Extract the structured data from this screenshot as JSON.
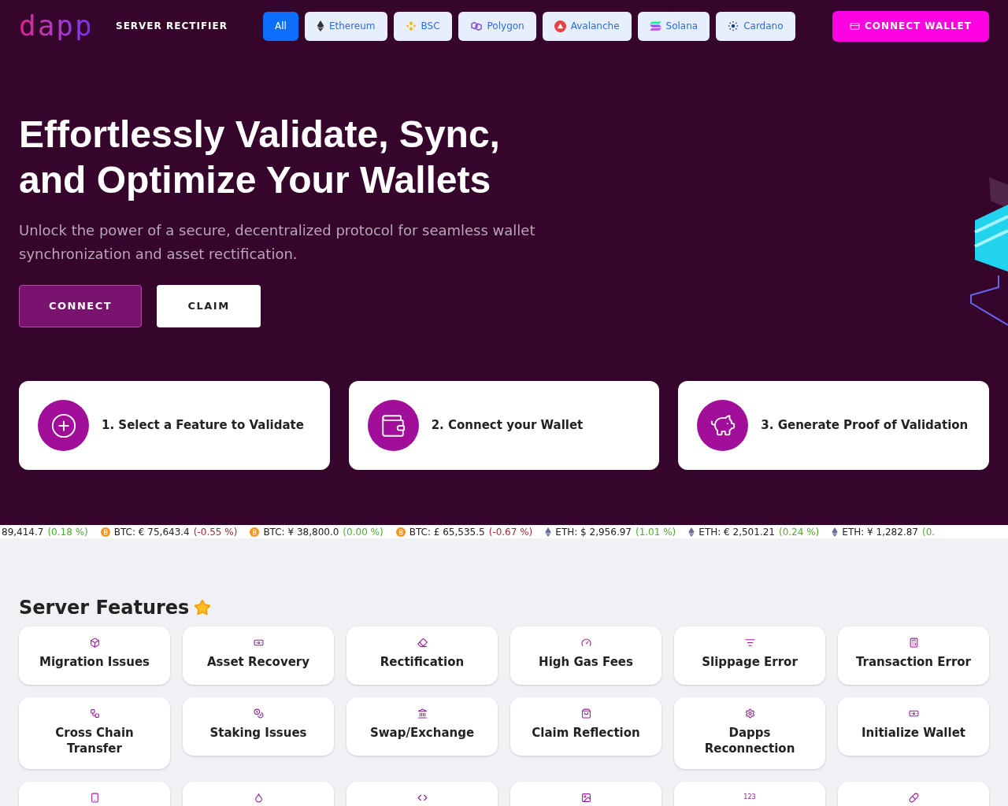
{
  "header": {
    "logo": "dapp",
    "title": "SERVER RECTIFIER",
    "chains": [
      {
        "label": "All",
        "kind": "all",
        "selected": true
      },
      {
        "label": "Ethereum",
        "kind": "eth",
        "selected": false
      },
      {
        "label": "BSC",
        "kind": "bsc",
        "selected": false
      },
      {
        "label": "Polygon",
        "kind": "polygon",
        "selected": false
      },
      {
        "label": "Avalanche",
        "kind": "avax",
        "selected": false
      },
      {
        "label": "Solana",
        "kind": "sol",
        "selected": false
      },
      {
        "label": "Cardano",
        "kind": "ada",
        "selected": false
      }
    ],
    "connect_wallet": "CONNECT WALLET"
  },
  "hero": {
    "title_lines": [
      "Effortlessly Validate, Sync,",
      "and Optimize Your Wallets"
    ],
    "subtitle": "Unlock the power of a secure, decentralized protocol for seamless wallet synchronization and asset rectification.",
    "buttons": [
      {
        "label": "CONNECT",
        "kind": "primary"
      },
      {
        "label": "CLAIM",
        "kind": "secondary"
      }
    ]
  },
  "steps": [
    {
      "label": "1. Select a Feature to Validate",
      "kind": "plus"
    },
    {
      "label": "2. Connect your Wallet",
      "kind": "wallet"
    },
    {
      "label": "3. Generate Proof of Validation",
      "kind": "piggy"
    }
  ],
  "ticker": [
    {
      "text": "89,414.7",
      "change": "(0.18 %)",
      "color": "#4cab32"
    },
    {
      "kind": "btc",
      "text": "BTC: € 75,643.4",
      "change": "(-0.55 %)",
      "color": "#a52a2a"
    },
    {
      "kind": "btc",
      "text": "BTC: ¥ 38,800.0",
      "change": "(0.00 %)",
      "color": "#4cab32"
    },
    {
      "kind": "btc",
      "text": "BTC: £ 65,535.5",
      "change": "(-0.67 %)",
      "color": "#a52a2a"
    },
    {
      "kind": "eth",
      "text": "ETH: $ 2,956.97",
      "change": "(1.01 %)",
      "color": "#4cab32"
    },
    {
      "kind": "eth",
      "text": "ETH: € 2,501.21",
      "change": "(0.24 %)",
      "color": "#4cab32"
    },
    {
      "kind": "eth",
      "text": "ETH: ¥ 1,282.87",
      "change": "(0.",
      "color": "#4cab32"
    }
  ],
  "features": {
    "title": "Server Features",
    "items": [
      {
        "label": "Migration Issues",
        "kind": "box"
      },
      {
        "label": "Asset Recovery",
        "kind": "money"
      },
      {
        "label": "Rectification",
        "kind": "eraser"
      },
      {
        "label": "High Gas Fees",
        "kind": "gauge"
      },
      {
        "label": "Slippage Error",
        "kind": "list"
      },
      {
        "label": "Transaction Error",
        "kind": "calc"
      },
      {
        "label": "Cross Chain Transfer",
        "kind": "nodes"
      },
      {
        "label": "Staking Issues",
        "kind": "coins"
      },
      {
        "label": "Swap/Exchange",
        "kind": "bank"
      },
      {
        "label": "Claim Reflection",
        "kind": "bag"
      },
      {
        "label": "Dapps Reconnection",
        "kind": "cog"
      },
      {
        "label": "Initialize Wallet",
        "kind": "money"
      },
      {
        "kind": "phone"
      },
      {
        "kind": "drop"
      },
      {
        "kind": "code"
      },
      {
        "kind": "image"
      },
      {
        "kind": "numbers",
        "icon_text": "123"
      },
      {
        "kind": "pill"
      }
    ]
  }
}
